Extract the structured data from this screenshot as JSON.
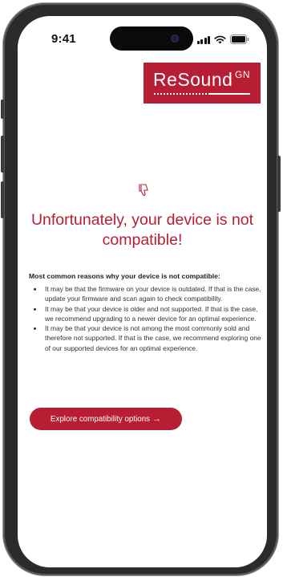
{
  "status_bar": {
    "time": "9:41"
  },
  "brand": {
    "name": "ReSound",
    "sub": "GN",
    "color": "#b81e33"
  },
  "icons": {
    "headline_icon": "thumbs-down-icon"
  },
  "message": {
    "title": "Unfortunately, your device is not compatible!",
    "reasons_title": "Most common reasons why your device is not compatible:",
    "reasons": [
      "It may be that the firmware on your device is outdated. If that is the case, update your firmware and scan again to check compatibility.",
      "It may be that your device is older and not supported. If that is the case, we recommend upgrading to a newer device for an optimal experience.",
      "It may be that your device is not among the most commonly sold and therefore not supported. If that is the case, we recommend exploring one of our supported devices for an optimal experience."
    ]
  },
  "cta": {
    "label": "Explore compatibility options",
    "arrow": "→"
  }
}
